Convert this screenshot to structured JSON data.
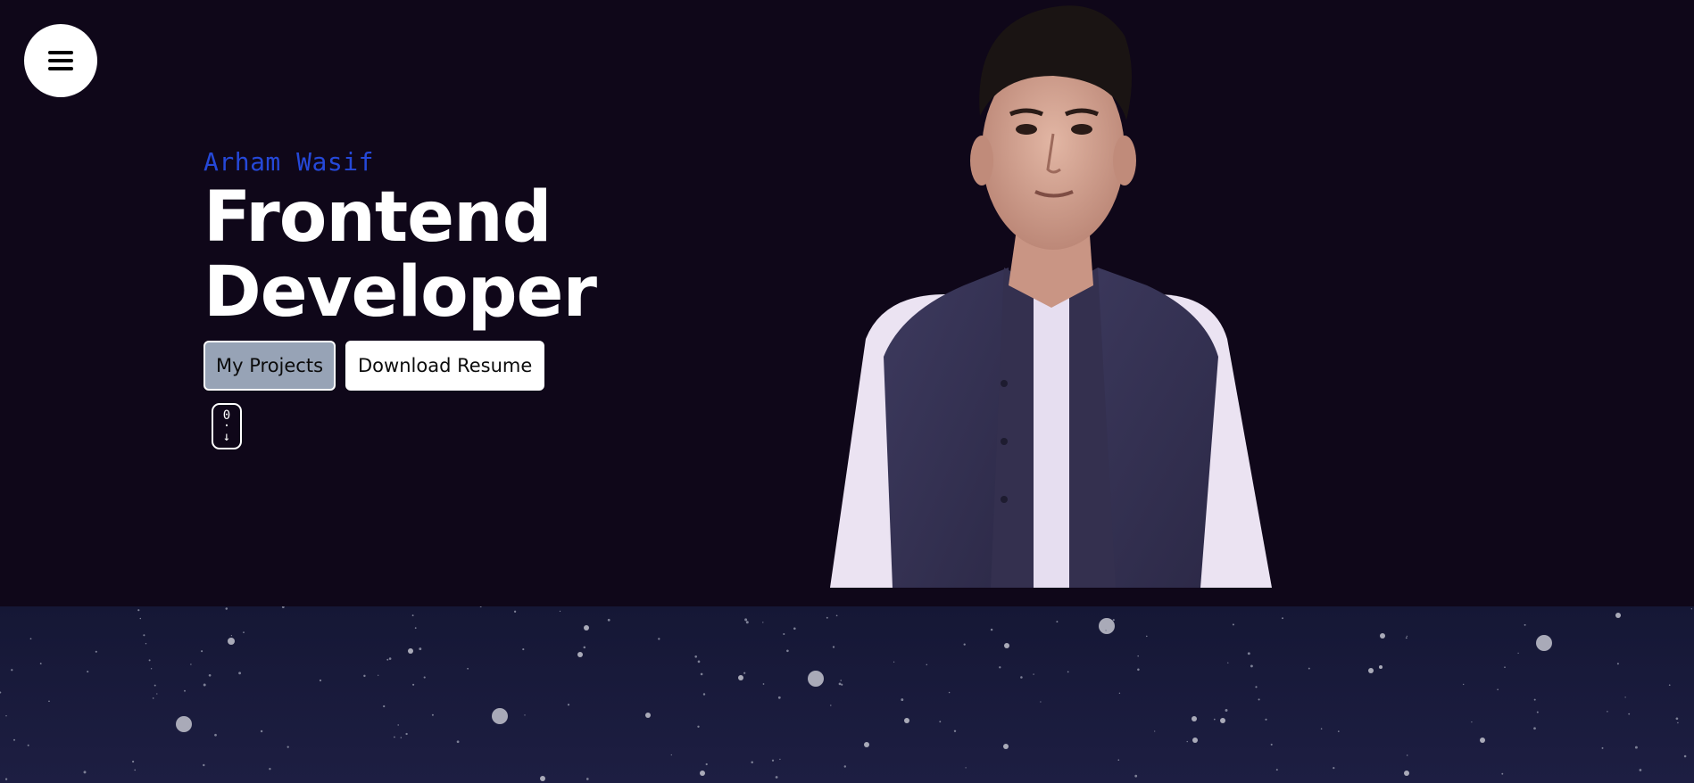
{
  "menu": {
    "icon": "hamburger-menu-icon"
  },
  "hero": {
    "name": "Arham Wasif",
    "title_line1": "Frontend",
    "title_line2": "Developer",
    "buttons": {
      "projects_label": "My Projects",
      "resume_label": "Download Resume"
    },
    "scroll_indicator": {
      "icon": "mouse-scroll-down-icon",
      "top_glyph": "0",
      "dot_glyph": "·",
      "arrow_glyph": "↓"
    },
    "portrait": {
      "icon": "profile-portrait-image"
    }
  },
  "colors": {
    "background": "#0f0719",
    "name_accent": "#2548d8",
    "projects_button_bg": "#97a3b6",
    "resume_button_bg": "#ffffff",
    "stars_band": "#151735"
  }
}
